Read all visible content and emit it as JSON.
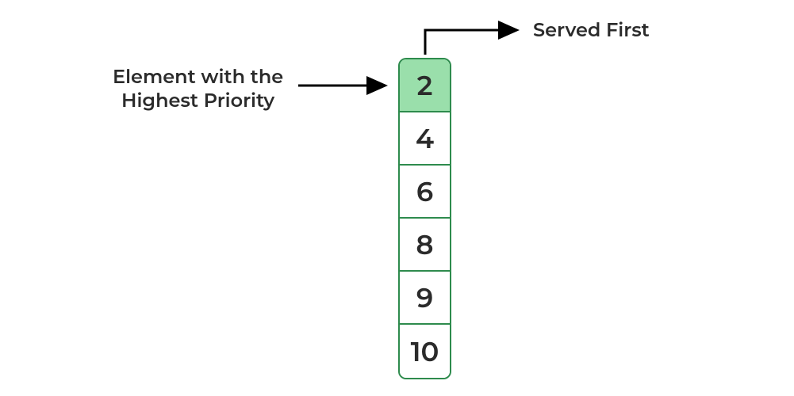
{
  "queue": {
    "cells": [
      "2",
      "4",
      "6",
      "8",
      "9",
      "10"
    ],
    "highlight_index": 0
  },
  "labels": {
    "left_line1": "Element with the",
    "left_line2": "Highest Priority",
    "right": "Served First"
  },
  "colors": {
    "border": "#2e8b4d",
    "highlight_bg": "#9adfab",
    "text": "#2b2b2b",
    "arrow": "#000000"
  }
}
